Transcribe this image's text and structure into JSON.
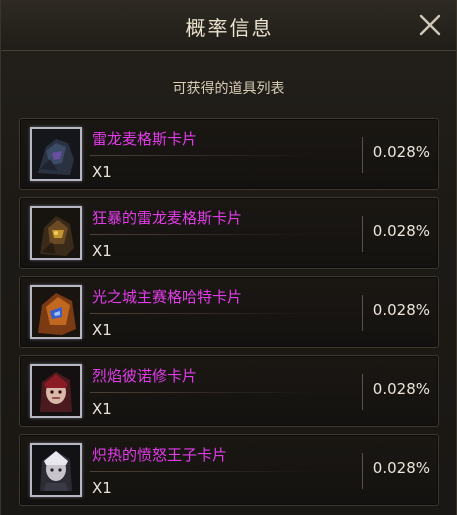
{
  "dialog": {
    "title": "概率信息",
    "subtitle": "可获得的道具列表",
    "close_icon": "close-icon"
  },
  "items": [
    {
      "name": "雷龙麦格斯卡片",
      "quantity": "X1",
      "probability": "0.028%",
      "icon": "card-thumbnail"
    },
    {
      "name": "狂暴的雷龙麦格斯卡片",
      "quantity": "X1",
      "probability": "0.028%",
      "icon": "card-thumbnail"
    },
    {
      "name": "光之城主赛格哈特卡片",
      "quantity": "X1",
      "probability": "0.028%",
      "icon": "card-thumbnail"
    },
    {
      "name": "烈焰彼诺修卡片",
      "quantity": "X1",
      "probability": "0.028%",
      "icon": "card-thumbnail"
    },
    {
      "name": "炽热的愤怒王子卡片",
      "quantity": "X1",
      "probability": "0.028%",
      "icon": "card-thumbnail"
    }
  ],
  "colors": {
    "item_name": "#e23ce8",
    "title": "#ece3cf",
    "background": "#1c1915"
  }
}
